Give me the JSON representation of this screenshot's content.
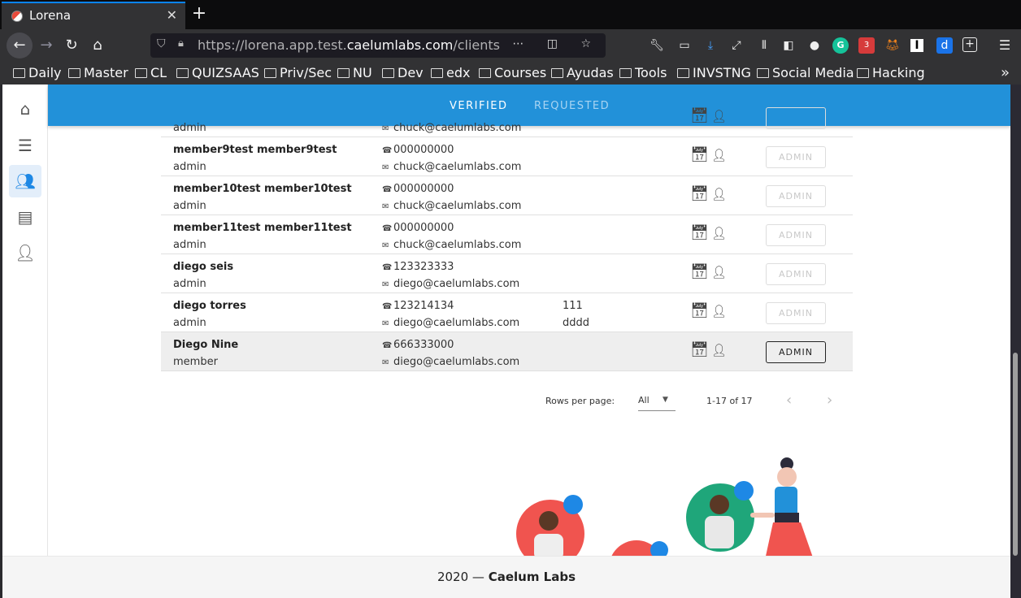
{
  "browser": {
    "tab_title": "Lorena",
    "url_prefix": "https://lorena.app.test.",
    "url_domain": "caelumlabs.com",
    "url_path": "/clients",
    "extension_badge": "3",
    "bookmarks": [
      "Daily",
      "Master",
      "CL",
      "QUIZSAAS",
      "Priv/Sec",
      "NU",
      "Dev",
      "edx",
      "Courses",
      "Ayudas",
      "Tools",
      "INVSTNG",
      "Social Media",
      "Hacking"
    ]
  },
  "tabs": {
    "verified": "VERIFIED",
    "requested": "REQUESTED"
  },
  "rows": [
    {
      "name": "",
      "role": "admin",
      "phone": "",
      "email": "chuck@caelumlabs.com",
      "extra1": "",
      "extra2": "",
      "button": ""
    },
    {
      "name": "member9test member9test",
      "role": "admin",
      "phone": "000000000",
      "email": "chuck@caelumlabs.com",
      "extra1": "",
      "extra2": "",
      "button": "ADMIN"
    },
    {
      "name": "member10test member10test",
      "role": "admin",
      "phone": "000000000",
      "email": "chuck@caelumlabs.com",
      "extra1": "",
      "extra2": "",
      "button": "ADMIN"
    },
    {
      "name": "member11test member11test",
      "role": "admin",
      "phone": "000000000",
      "email": "chuck@caelumlabs.com",
      "extra1": "",
      "extra2": "",
      "button": "ADMIN"
    },
    {
      "name": "diego seis",
      "role": "admin",
      "phone": "123323333",
      "email": "diego@caelumlabs.com",
      "extra1": "",
      "extra2": "",
      "button": "ADMIN"
    },
    {
      "name": "diego torres",
      "role": "admin",
      "phone": "123214134",
      "email": "diego@caelumlabs.com",
      "extra1": "111",
      "extra2": "dddd",
      "button": "ADMIN"
    },
    {
      "name": "Diego Nine",
      "role": "member",
      "phone": "666333000",
      "email": "diego@caelumlabs.com",
      "extra1": "",
      "extra2": "",
      "button": "ADMIN"
    }
  ],
  "pagination": {
    "rows_per_page_label": "Rows per page:",
    "rows_per_page_value": "All",
    "range": "1-17 of 17"
  },
  "footer": {
    "year": "2020 —",
    "company": "Caelum Labs"
  },
  "colors": {
    "primary": "#2291d9",
    "accent": "#1e88e5"
  }
}
